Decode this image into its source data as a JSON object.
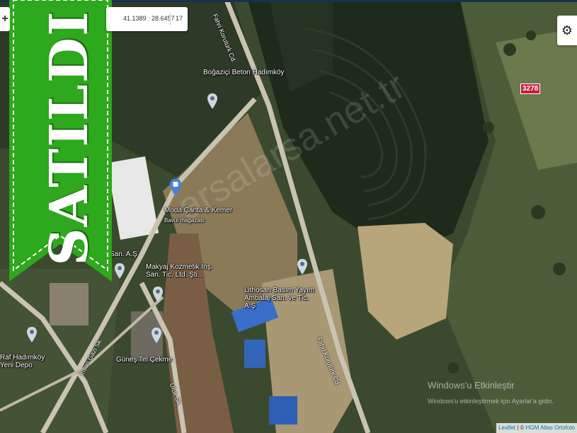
{
  "map": {
    "coordinates": "41.1389 : 28.6457",
    "zoom_level": "17",
    "zoom_in_label": "+",
    "settings_icon": "gear-icon",
    "parcel_label": "3278",
    "banner_text": "SATILDI",
    "watermark": "arsalarsa.net.tr",
    "places": {
      "bogazici": "Boğaziçi Beton Hadımköy",
      "moda": "Moda Çanta & Kemer",
      "moda_sub": "Bavul mağazası",
      "makyaj": "Makyaj Kozmetik İnş. San. Tic. Ltd. Şti...",
      "lithosan": "Lithosan Basım Yayım Ambalaj San. ve Tic. A.Ş",
      "gunes": "Güneş Tel Çekme",
      "raf": "Raf Hadımköy Yeni Depo",
      "san_as": "San. A.Ş"
    },
    "roads": {
      "fahri_top": "Fahri Korutürk Cd.",
      "fahri_bottom": "Fahri Korutürk Cd.",
      "ihsan": "İhsan Gazi Sk.",
      "ufuk": "Ufuk Sk."
    },
    "windows_notice": {
      "title": "Windows'u Etkinleştir",
      "subtitle": "Windows'u etkinleştirmek için Ayarlar'a gidin."
    },
    "attribution": {
      "leaflet": "Leaflet",
      "separator": " | © ",
      "provider": "HGM Atlas Ortofoto"
    },
    "colors": {
      "banner_green": "#2ea81c",
      "parcel_red": "#c81e3a",
      "top_strip": "#16324f"
    }
  }
}
